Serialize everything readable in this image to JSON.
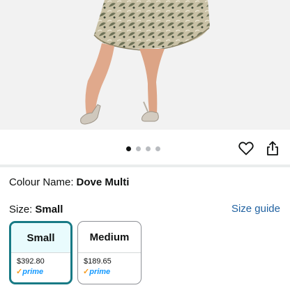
{
  "product_image": {
    "alt": "Dress model photo",
    "dots": 4,
    "active_dot": 0
  },
  "actions": {
    "wishlist": "heart-icon",
    "share": "share-icon"
  },
  "colour": {
    "label": "Colour Name:",
    "value": "Dove Multi"
  },
  "size": {
    "label": "Size:",
    "value": "Small",
    "guide_link": "Size guide"
  },
  "size_options": [
    {
      "name": "Small",
      "price": "$392.80",
      "prime": "prime",
      "selected": true
    },
    {
      "name": "Medium",
      "price": "$189.65",
      "prime": "prime",
      "selected": false
    }
  ],
  "colors": {
    "accent": "#187a85",
    "link": "#2162a1",
    "prime_blue": "#1399ff",
    "prime_check": "#f79a1c"
  }
}
